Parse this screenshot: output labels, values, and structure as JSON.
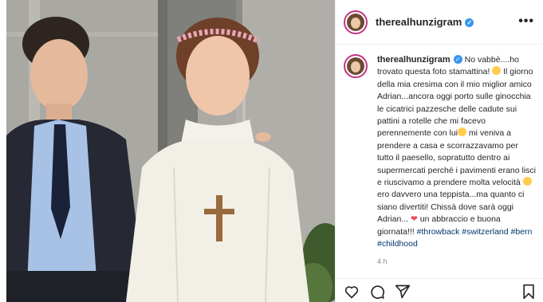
{
  "header": {
    "username": "therealhunzigram",
    "verified_mark": "✓",
    "more_label": "•••"
  },
  "caption": {
    "username": "therealhunzigram",
    "text_1": " No vabbè....ho trovato questa foto stamattina! ",
    "text_2": " Il giorno della mia cresima con il mio miglior amico Adrian...ancora oggi porto sulle ginocchia le cicatrici pazzesche delle cadute sui pattini a rotelle che mi facevo perennemente con lui",
    "text_3": " mi veniva a prendere a casa e scorrazzavamo per tutto il paesello, sopratutto dentro ai supermercati perché i pavimenti erano lisci e riuscivamo a prendere molta velocità ",
    "text_4": " ero davvero una teppista...ma quanto ci siano divertiti! Chissà dove sarà oggi Adrian... ",
    "text_5": " un abbraccio e buona giornata!!! ",
    "hashtags_1": "#throwback",
    "hashtags_2": "#switzerland #bern #childhood",
    "time": "4 h"
  },
  "icons": {
    "like": "heart-outline-icon",
    "comment": "comment-icon",
    "share": "paper-plane-icon",
    "save": "bookmark-icon",
    "more": "more-dots-icon",
    "verified": "verified-badge-icon"
  },
  "colors": {
    "hashtag": "#00376b",
    "verified": "#3897f0",
    "story_ring": "#c13584",
    "meta": "#8e8e8e"
  }
}
